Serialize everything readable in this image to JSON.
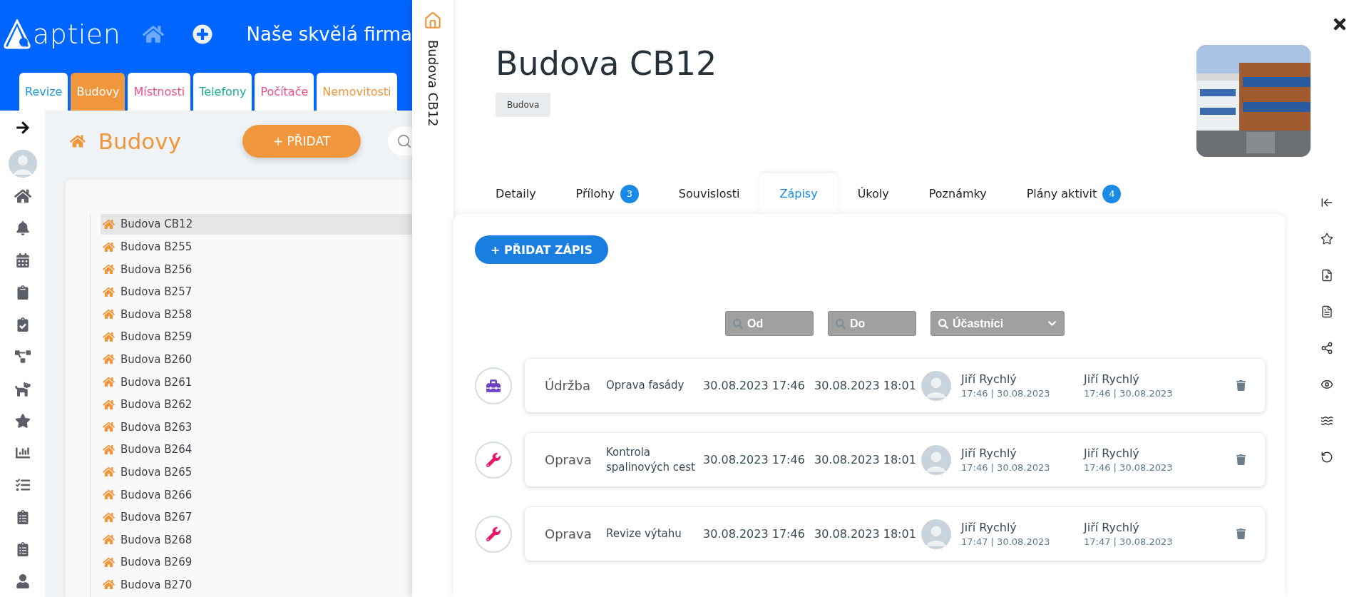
{
  "app_header": {
    "logo_text": "aptien",
    "company": "Naše skvělá firma"
  },
  "module_tabs": [
    {
      "label": "Revize",
      "color": "#1a9be0",
      "selected": false
    },
    {
      "label": "Budovy",
      "color": "#ffffff",
      "selected": true
    },
    {
      "label": "Místnosti",
      "color": "#ea4f86",
      "selected": false
    },
    {
      "label": "Telefony",
      "color": "#16b08f",
      "selected": false
    },
    {
      "label": "Počítače",
      "color": "#ea4f86",
      "selected": false
    },
    {
      "label": "Nemovitosti",
      "color": "#f0963c",
      "selected": false
    }
  ],
  "list_page": {
    "title": "Budovy",
    "add_button": "+ PŘIDAT"
  },
  "tree": {
    "items": [
      {
        "label": "Budova CB12",
        "selected": true
      },
      {
        "label": "Budova B255",
        "selected": false
      },
      {
        "label": "Budova B256",
        "selected": false
      },
      {
        "label": "Budova B257",
        "selected": false
      },
      {
        "label": "Budova B258",
        "selected": false
      },
      {
        "label": "Budova B259",
        "selected": false
      },
      {
        "label": "Budova B260",
        "selected": false
      },
      {
        "label": "Budova B261",
        "selected": false
      },
      {
        "label": "Budova B262",
        "selected": false
      },
      {
        "label": "Budova B263",
        "selected": false
      },
      {
        "label": "Budova B264",
        "selected": false
      },
      {
        "label": "Budova B265",
        "selected": false
      },
      {
        "label": "Budova B266",
        "selected": false
      },
      {
        "label": "Budova B267",
        "selected": false
      },
      {
        "label": "Budova B268",
        "selected": false
      },
      {
        "label": "Budova B269",
        "selected": false
      },
      {
        "label": "Budova B270",
        "selected": false
      }
    ]
  },
  "detail": {
    "side_title": "Budova CB12",
    "title": "Budova CB12",
    "tag": "Budova",
    "tabs": [
      {
        "label": "Detaily",
        "selected": false
      },
      {
        "label": "Přílohy",
        "badge": "3",
        "selected": false
      },
      {
        "label": "Souvislosti",
        "selected": false
      },
      {
        "label": "Zápisy",
        "selected": true
      },
      {
        "label": "Úkoly",
        "selected": false
      },
      {
        "label": "Poznámky",
        "selected": false
      },
      {
        "label": "Plány aktivit",
        "badge": "4",
        "selected": false
      }
    ],
    "add_button": "+ PŘIDAT ZÁPIS",
    "filters": [
      {
        "label": "Od",
        "kind": "search"
      },
      {
        "label": "Do",
        "kind": "search"
      },
      {
        "label": "Účastníci",
        "kind": "select"
      }
    ],
    "records": [
      {
        "kind": "maintenance",
        "type": "Údržba",
        "title": "Oprava fasády",
        "start": "30.08.2023 17:46",
        "end": "30.08.2023 18:01",
        "created_by": "Jiří Rychlý",
        "created_at": "17:46 | 30.08.2023",
        "updated_by": "Jiří Rychlý",
        "updated_at": "17:46 | 30.08.2023"
      },
      {
        "kind": "repair",
        "type": "Oprava",
        "title": "Kontrola spalinových cest",
        "start": "30.08.2023 17:46",
        "end": "30.08.2023 18:01",
        "created_by": "Jiří Rychlý",
        "created_at": "17:46 | 30.08.2023",
        "updated_by": "Jiří Rychlý",
        "updated_at": "17:46 | 30.08.2023"
      },
      {
        "kind": "repair",
        "type": "Oprava",
        "title": "Revize výtahu",
        "start": "30.08.2023 17:46",
        "end": "30.08.2023 18:01",
        "created_by": "Jiří Rychlý",
        "created_at": "17:47 | 30.08.2023",
        "updated_by": "Jiří Rychlý",
        "updated_at": "17:47 | 30.08.2023"
      }
    ]
  }
}
